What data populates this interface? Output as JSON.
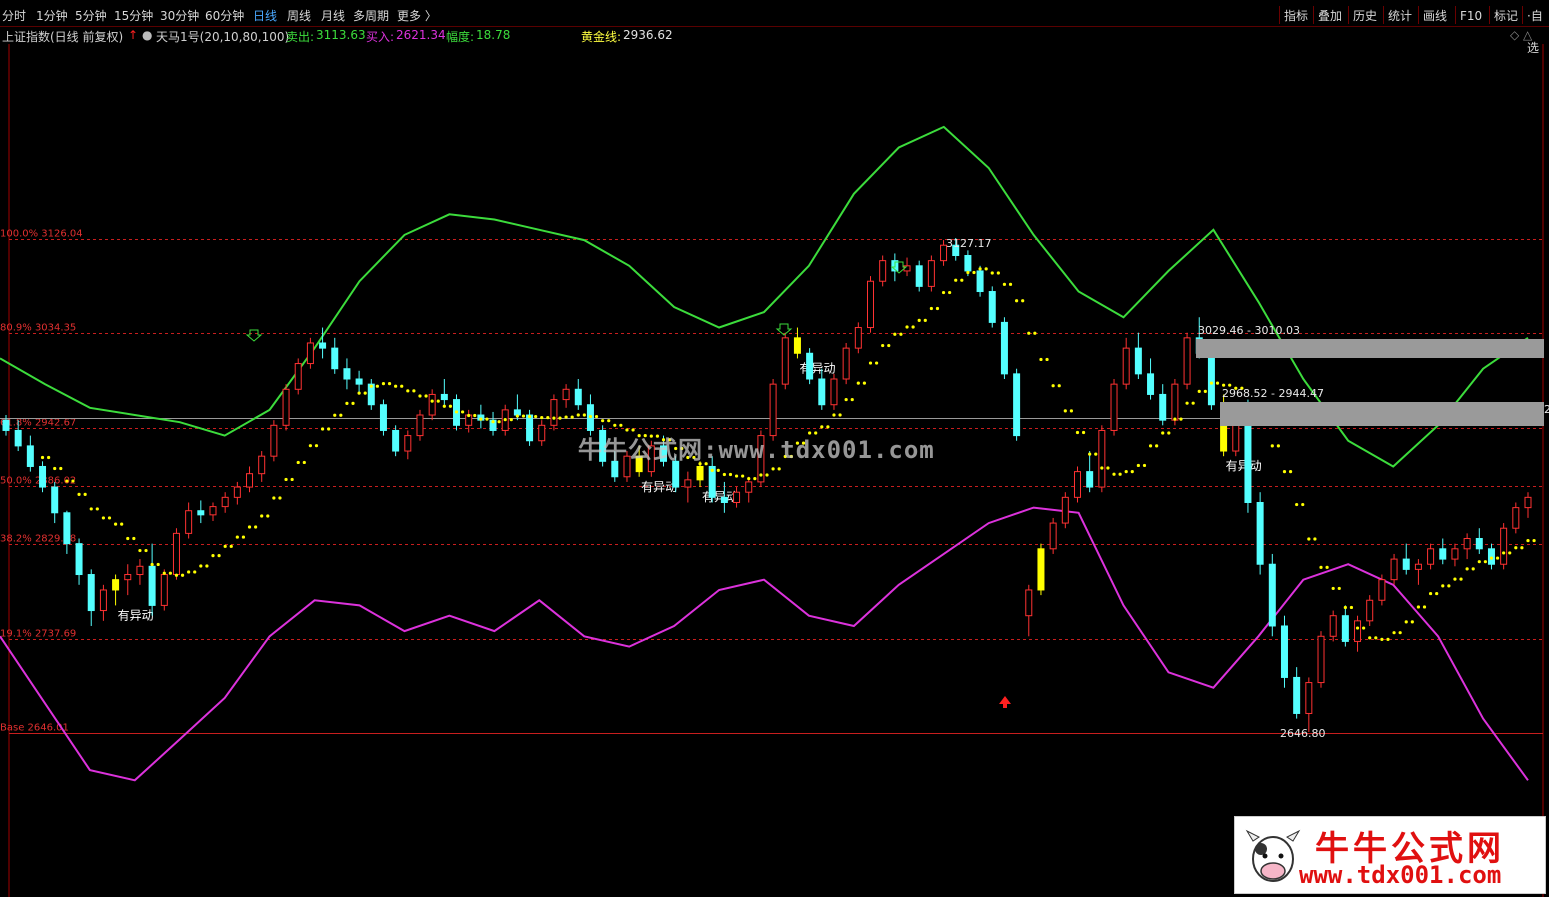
{
  "toolbar": {
    "left": [
      "分时",
      "1分钟",
      "5分钟",
      "15分钟",
      "30分钟",
      "60分钟",
      "日线",
      "周线",
      "月线",
      "多周期",
      "更多 〉"
    ],
    "active": "日线",
    "right": [
      "指标",
      "叠加",
      "历史",
      "统计",
      "画线",
      "F10",
      "标记",
      "·自选"
    ]
  },
  "infobar": {
    "title": "上证指数(日线 前复权)",
    "indicator": "天马1号(20,10,80,100)",
    "sell_label": "卖出:",
    "sell_value": "3113.63",
    "buy_label": "买入:",
    "buy_value": "2621.34",
    "amp_label": "幅度:",
    "amp_value": "18.78",
    "gold_label": "黄金线:",
    "gold_value": "2936.62",
    "right_marks": "◇ △"
  },
  "fib_levels": [
    {
      "label": "100.0% 3126.04",
      "value": 3126.04
    },
    {
      "label": "80.9% 3034.35",
      "value": 3034.35
    },
    {
      "label": "61.8% 2942.67",
      "value": 2942.67
    },
    {
      "label": "50.0% 2886.02",
      "value": 2886.02
    },
    {
      "label": "38.2% 2829.38",
      "value": 2829.38
    },
    {
      "label": "19.1% 2737.69",
      "value": 2737.69
    },
    {
      "label": "Base 2646.01",
      "value": 2646.01
    }
  ],
  "annotations": {
    "high": "3127.17",
    "low": "2646.80",
    "zone1": "3029.46 - 3010.03",
    "zone2": "2968.52 - 2944.47",
    "yidong": "有异动",
    "right_price": "2"
  },
  "watermark": "牛牛公式网:www.tdx001.com",
  "logo": {
    "title": "牛牛公式网",
    "url": "www.tdx001.com"
  },
  "colors": {
    "up": "#ff3232",
    "down": "#54ffff",
    "signal": "#ffff00",
    "upper_band": "#3cdc3c",
    "lower_band": "#dc32dc",
    "fib_line": "#c81e1e",
    "zone": "#9a9a9a",
    "active_tab": "#4aa8ff"
  },
  "chart_data": {
    "type": "candlestick",
    "ylim": [
      2646.01,
      3126.04
    ],
    "candles": [
      [
        2950,
        2955,
        2935,
        2940
      ],
      [
        2940,
        2950,
        2920,
        2925
      ],
      [
        2925,
        2935,
        2900,
        2905
      ],
      [
        2905,
        2910,
        2880,
        2885
      ],
      [
        2885,
        2890,
        2850,
        2860
      ],
      [
        2860,
        2862,
        2820,
        2830
      ],
      [
        2830,
        2835,
        2790,
        2800
      ],
      [
        2800,
        2805,
        2750,
        2765
      ],
      [
        2765,
        2790,
        2755,
        2785
      ],
      [
        2785,
        2800,
        2770,
        2795
      ],
      [
        2795,
        2810,
        2780,
        2800
      ],
      [
        2800,
        2815,
        2790,
        2808
      ],
      [
        2808,
        2830,
        2760,
        2770
      ],
      [
        2770,
        2805,
        2765,
        2800
      ],
      [
        2800,
        2845,
        2795,
        2840
      ],
      [
        2840,
        2870,
        2835,
        2862
      ],
      [
        2862,
        2872,
        2850,
        2858
      ],
      [
        2858,
        2870,
        2852,
        2866
      ],
      [
        2866,
        2880,
        2860,
        2875
      ],
      [
        2875,
        2890,
        2868,
        2885
      ],
      [
        2885,
        2905,
        2880,
        2898
      ],
      [
        2898,
        2920,
        2890,
        2915
      ],
      [
        2915,
        2950,
        2910,
        2945
      ],
      [
        2945,
        2985,
        2940,
        2980
      ],
      [
        2980,
        3010,
        2975,
        3005
      ],
      [
        3005,
        3030,
        3000,
        3025
      ],
      [
        3025,
        3040,
        3010,
        3020
      ],
      [
        3020,
        3030,
        2995,
        3000
      ],
      [
        3000,
        3010,
        2980,
        2990
      ],
      [
        2990,
        2998,
        2975,
        2985
      ],
      [
        2985,
        2990,
        2960,
        2965
      ],
      [
        2965,
        2970,
        2935,
        2940
      ],
      [
        2940,
        2945,
        2915,
        2920
      ],
      [
        2920,
        2940,
        2912,
        2935
      ],
      [
        2935,
        2960,
        2930,
        2955
      ],
      [
        2955,
        2980,
        2950,
        2975
      ],
      [
        2975,
        2990,
        2965,
        2970
      ],
      [
        2970,
        2975,
        2940,
        2945
      ],
      [
        2945,
        2960,
        2938,
        2955
      ],
      [
        2955,
        2965,
        2942,
        2950
      ],
      [
        2950,
        2958,
        2935,
        2940
      ],
      [
        2940,
        2965,
        2935,
        2960
      ],
      [
        2960,
        2975,
        2950,
        2955
      ],
      [
        2955,
        2960,
        2925,
        2930
      ],
      [
        2930,
        2950,
        2925,
        2945
      ],
      [
        2945,
        2975,
        2940,
        2970
      ],
      [
        2970,
        2985,
        2962,
        2980
      ],
      [
        2980,
        2990,
        2960,
        2965
      ],
      [
        2965,
        2975,
        2935,
        2940
      ],
      [
        2940,
        2945,
        2905,
        2910
      ],
      [
        2910,
        2920,
        2890,
        2895
      ],
      [
        2895,
        2920,
        2890,
        2915
      ],
      [
        2915,
        2925,
        2895,
        2900
      ],
      [
        2900,
        2930,
        2895,
        2925
      ],
      [
        2925,
        2935,
        2905,
        2910
      ],
      [
        2910,
        2915,
        2880,
        2885
      ],
      [
        2885,
        2900,
        2870,
        2892
      ],
      [
        2892,
        2910,
        2885,
        2905
      ],
      [
        2905,
        2915,
        2870,
        2875
      ],
      [
        2875,
        2890,
        2860,
        2870
      ],
      [
        2870,
        2885,
        2865,
        2880
      ],
      [
        2880,
        2895,
        2870,
        2890
      ],
      [
        2890,
        2940,
        2885,
        2935
      ],
      [
        2935,
        2990,
        2930,
        2985
      ],
      [
        2985,
        3035,
        2980,
        3030
      ],
      [
        3030,
        3040,
        3010,
        3015
      ],
      [
        3015,
        3020,
        2985,
        2990
      ],
      [
        2990,
        3000,
        2960,
        2965
      ],
      [
        2965,
        2995,
        2960,
        2990
      ],
      [
        2990,
        3025,
        2985,
        3020
      ],
      [
        3020,
        3045,
        3015,
        3040
      ],
      [
        3040,
        3090,
        3035,
        3085
      ],
      [
        3085,
        3110,
        3080,
        3105
      ],
      [
        3105,
        3112,
        3085,
        3095
      ],
      [
        3095,
        3108,
        3090,
        3100
      ],
      [
        3100,
        3105,
        3075,
        3080
      ],
      [
        3080,
        3110,
        3075,
        3105
      ],
      [
        3105,
        3125,
        3100,
        3120
      ],
      [
        3120,
        3127,
        3105,
        3110
      ],
      [
        3110,
        3115,
        3090,
        3095
      ],
      [
        3095,
        3100,
        3070,
        3075
      ],
      [
        3075,
        3080,
        3040,
        3045
      ],
      [
        3045,
        3050,
        2990,
        2995
      ],
      [
        2995,
        3000,
        2930,
        2935
      ],
      [
        2760,
        2790,
        2740,
        2785
      ],
      [
        2785,
        2830,
        2780,
        2825
      ],
      [
        2825,
        2855,
        2820,
        2850
      ],
      [
        2850,
        2880,
        2845,
        2875
      ],
      [
        2875,
        2905,
        2870,
        2900
      ],
      [
        2900,
        2920,
        2880,
        2885
      ],
      [
        2885,
        2945,
        2880,
        2940
      ],
      [
        2940,
        2990,
        2935,
        2985
      ],
      [
        2985,
        3030,
        2980,
        3020
      ],
      [
        3020,
        3035,
        2990,
        2995
      ],
      [
        2995,
        3010,
        2970,
        2975
      ],
      [
        2975,
        2985,
        2945,
        2950
      ],
      [
        2950,
        2990,
        2945,
        2985
      ],
      [
        2985,
        3035,
        2980,
        3030
      ],
      [
        3030,
        3050,
        3010,
        3015
      ],
      [
        3015,
        3020,
        2960,
        2965
      ],
      [
        2965,
        2975,
        2915,
        2920
      ],
      [
        2920,
        2960,
        2915,
        2955
      ],
      [
        2955,
        2970,
        2860,
        2870
      ],
      [
        2870,
        2880,
        2800,
        2810
      ],
      [
        2810,
        2820,
        2740,
        2750
      ],
      [
        2750,
        2760,
        2690,
        2700
      ],
      [
        2700,
        2710,
        2660,
        2665
      ],
      [
        2665,
        2700,
        2647,
        2695
      ],
      [
        2695,
        2745,
        2690,
        2740
      ],
      [
        2740,
        2765,
        2735,
        2760
      ],
      [
        2760,
        2770,
        2730,
        2735
      ],
      [
        2735,
        2760,
        2725,
        2755
      ],
      [
        2755,
        2780,
        2750,
        2775
      ],
      [
        2775,
        2800,
        2770,
        2795
      ],
      [
        2795,
        2820,
        2790,
        2815
      ],
      [
        2815,
        2830,
        2800,
        2805
      ],
      [
        2805,
        2815,
        2790,
        2810
      ],
      [
        2810,
        2830,
        2805,
        2825
      ],
      [
        2825,
        2835,
        2810,
        2815
      ],
      [
        2815,
        2830,
        2808,
        2825
      ],
      [
        2825,
        2840,
        2815,
        2835
      ],
      [
        2835,
        2845,
        2820,
        2825
      ],
      [
        2825,
        2830,
        2805,
        2810
      ],
      [
        2810,
        2850,
        2805,
        2845
      ],
      [
        2845,
        2870,
        2840,
        2865
      ],
      [
        2865,
        2880,
        2855,
        2875
      ]
    ],
    "signal_markers": {
      "yidong_candles": [
        9,
        52,
        57,
        65,
        100,
        131,
        143,
        173
      ],
      "big_yellow": [
        85
      ]
    },
    "upper_band": [
      3010,
      2985,
      2962,
      2955,
      2948,
      2935,
      2960,
      3020,
      3085,
      3130,
      3150,
      3145,
      3135,
      3125,
      3100,
      3060,
      3040,
      3055,
      3100,
      3170,
      3215,
      3235,
      3195,
      3130,
      3075,
      3050,
      3095,
      3135,
      3065,
      2990,
      2930,
      2905,
      2945,
      3000,
      3030
    ],
    "lower_band": [
      2740,
      2675,
      2610,
      2600,
      2640,
      2680,
      2740,
      2775,
      2770,
      2745,
      2760,
      2745,
      2775,
      2740,
      2730,
      2750,
      2785,
      2795,
      2760,
      2750,
      2790,
      2820,
      2850,
      2865,
      2860,
      2770,
      2705,
      2690,
      2740,
      2795,
      2810,
      2790,
      2740,
      2660,
      2600
    ]
  }
}
